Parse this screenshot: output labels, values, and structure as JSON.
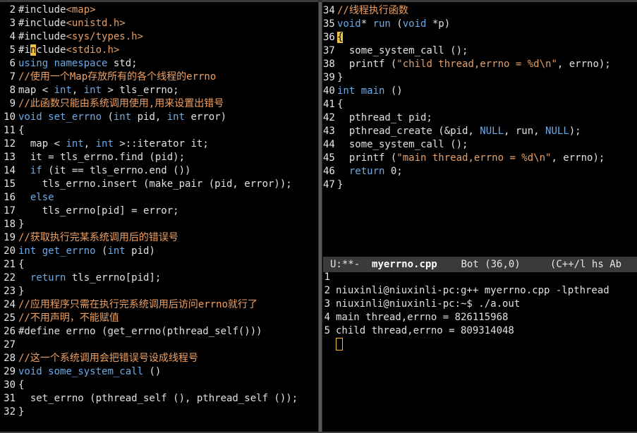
{
  "left_pane": {
    "lines": [
      {
        "n": "2",
        "parts": [
          [
            "pp",
            "#include"
          ],
          [
            "str",
            "<map>"
          ]
        ]
      },
      {
        "n": "3",
        "parts": [
          [
            "pp",
            "#include"
          ],
          [
            "str",
            "<unistd.h>"
          ]
        ]
      },
      {
        "n": "4",
        "parts": [
          [
            "pp",
            "#include"
          ],
          [
            "str",
            "<sys/types.h>"
          ]
        ]
      },
      {
        "n": "5",
        "parts": [
          [
            "pp",
            "#i"
          ],
          [
            "cur",
            "n"
          ],
          [
            "pp",
            "clude"
          ],
          [
            "str",
            "<stdio.h>"
          ]
        ]
      },
      {
        "n": "6",
        "parts": [
          [
            "k",
            "using"
          ],
          [
            "code",
            " "
          ],
          [
            "k",
            "namespace"
          ],
          [
            "code",
            " std;"
          ]
        ]
      },
      {
        "n": "7",
        "parts": [
          [
            "cm",
            "//使用一个Map存放所有的各个线程的errno"
          ]
        ]
      },
      {
        "n": "8",
        "parts": [
          [
            "code",
            "map < "
          ],
          [
            "k",
            "int"
          ],
          [
            "code",
            ", "
          ],
          [
            "k",
            "int"
          ],
          [
            "code",
            " > tls_errno;"
          ]
        ]
      },
      {
        "n": "9",
        "parts": [
          [
            "cm",
            "//此函数只能由系统调用使用,用来设置出错号"
          ]
        ]
      },
      {
        "n": "10",
        "parts": [
          [
            "k",
            "void"
          ],
          [
            "code",
            " "
          ],
          [
            "k",
            "set_errno"
          ],
          [
            "code",
            " ("
          ],
          [
            "k",
            "int"
          ],
          [
            "code",
            " pid, "
          ],
          [
            "k",
            "int"
          ],
          [
            "code",
            " error)"
          ]
        ]
      },
      {
        "n": "11",
        "parts": [
          [
            "code",
            "{"
          ]
        ]
      },
      {
        "n": "12",
        "parts": [
          [
            "code",
            "  map < "
          ],
          [
            "k",
            "int"
          ],
          [
            "code",
            ", "
          ],
          [
            "k",
            "int"
          ],
          [
            "code",
            " >::iterator it;"
          ]
        ]
      },
      {
        "n": "13",
        "parts": [
          [
            "code",
            "  it = tls_errno.find (pid);"
          ]
        ]
      },
      {
        "n": "14",
        "parts": [
          [
            "code",
            "  "
          ],
          [
            "k",
            "if"
          ],
          [
            "code",
            " (it == tls_errno.end ())"
          ]
        ]
      },
      {
        "n": "15",
        "parts": [
          [
            "code",
            "    tls_errno.insert (make_pair (pid, error));"
          ]
        ]
      },
      {
        "n": "16",
        "parts": [
          [
            "code",
            "  "
          ],
          [
            "k",
            "else"
          ]
        ]
      },
      {
        "n": "17",
        "parts": [
          [
            "code",
            "    tls_errno[pid] = error;"
          ]
        ]
      },
      {
        "n": "18",
        "parts": [
          [
            "code",
            "}"
          ]
        ]
      },
      {
        "n": "19",
        "parts": [
          [
            "cm",
            "//获取执行完某系统调用后的错误号"
          ]
        ]
      },
      {
        "n": "20",
        "parts": [
          [
            "k",
            "int"
          ],
          [
            "code",
            " "
          ],
          [
            "k",
            "get_errno"
          ],
          [
            "code",
            " ("
          ],
          [
            "k",
            "int"
          ],
          [
            "code",
            " pid)"
          ]
        ]
      },
      {
        "n": "21",
        "parts": [
          [
            "code",
            "{"
          ]
        ]
      },
      {
        "n": "22",
        "parts": [
          [
            "code",
            "  "
          ],
          [
            "k",
            "return"
          ],
          [
            "code",
            " tls_errno[pid];"
          ]
        ]
      },
      {
        "n": "23",
        "parts": [
          [
            "code",
            "}"
          ]
        ]
      },
      {
        "n": "24",
        "parts": [
          [
            "cm",
            "//应用程序只需在执行完系统调用后访问errno就行了"
          ]
        ]
      },
      {
        "n": "25",
        "parts": [
          [
            "cm",
            "//不用声明，不能赋值"
          ]
        ]
      },
      {
        "n": "26",
        "parts": [
          [
            "pp",
            "#define"
          ],
          [
            "code",
            " errno (get_errno(pthread_self()))"
          ]
        ]
      },
      {
        "n": "27",
        "parts": [
          [
            "code",
            ""
          ]
        ]
      },
      {
        "n": "28",
        "parts": [
          [
            "cm",
            "//这一个系统调用会把错误号设成线程号"
          ]
        ]
      },
      {
        "n": "29",
        "parts": [
          [
            "k",
            "void"
          ],
          [
            "code",
            " "
          ],
          [
            "k",
            "some_system_call"
          ],
          [
            "code",
            " ()"
          ]
        ]
      },
      {
        "n": "30",
        "parts": [
          [
            "code",
            "{"
          ]
        ]
      },
      {
        "n": "31",
        "parts": [
          [
            "code",
            "  set_errno (pthread_self (), pthread_self ());"
          ]
        ]
      },
      {
        "n": "32",
        "parts": [
          [
            "code",
            "}"
          ]
        ]
      }
    ]
  },
  "right_top_pane": {
    "lines": [
      {
        "n": "34",
        "parts": [
          [
            "cm",
            "//线程执行函数"
          ]
        ]
      },
      {
        "n": "35",
        "parts": [
          [
            "k",
            "void"
          ],
          [
            "code",
            "* "
          ],
          [
            "k",
            "run"
          ],
          [
            "code",
            " ("
          ],
          [
            "k",
            "void"
          ],
          [
            "code",
            " *p)"
          ]
        ]
      },
      {
        "n": "36",
        "parts": [
          [
            "cur",
            "{"
          ]
        ]
      },
      {
        "n": "37",
        "parts": [
          [
            "code",
            "  some_system_call ();"
          ]
        ]
      },
      {
        "n": "38",
        "parts": [
          [
            "code",
            "  printf ("
          ],
          [
            "str",
            "\"child thread,errno = %d\\n\""
          ],
          [
            "code",
            ", errno);"
          ]
        ]
      },
      {
        "n": "39",
        "parts": [
          [
            "code",
            "}"
          ]
        ]
      },
      {
        "n": "40",
        "parts": [
          [
            "k",
            "int"
          ],
          [
            "code",
            " "
          ],
          [
            "k",
            "main"
          ],
          [
            "code",
            " ()"
          ]
        ]
      },
      {
        "n": "41",
        "parts": [
          [
            "code",
            "{"
          ]
        ]
      },
      {
        "n": "42",
        "parts": [
          [
            "code",
            "  pthread_t pid;"
          ]
        ]
      },
      {
        "n": "43",
        "parts": [
          [
            "code",
            "  pthread_create (&pid, "
          ],
          [
            "k",
            "NULL"
          ],
          [
            "code",
            ", run, "
          ],
          [
            "k",
            "NULL"
          ],
          [
            "code",
            ");"
          ]
        ]
      },
      {
        "n": "44",
        "parts": [
          [
            "code",
            "  some_system_call ();"
          ]
        ]
      },
      {
        "n": "45",
        "parts": [
          [
            "code",
            "  printf ("
          ],
          [
            "str",
            "\"main thread,errno = %d\\n\""
          ],
          [
            "code",
            ", errno);"
          ]
        ]
      },
      {
        "n": "46",
        "parts": [
          [
            "code",
            "  "
          ],
          [
            "k",
            "return"
          ],
          [
            "code",
            " 0;"
          ]
        ]
      },
      {
        "n": "47",
        "parts": [
          [
            "code",
            "}"
          ]
        ]
      }
    ]
  },
  "modeline": {
    "status": "U:**-",
    "filename": "myerrno.cpp",
    "position": "Bot (36,0)",
    "mode": "(C++/l hs Ab"
  },
  "terminal_pane": {
    "lines": [
      {
        "n": "1",
        "text": ""
      },
      {
        "n": "2",
        "text": "niuxinli@niuxinli-pc:g++ myerrno.cpp -lpthread"
      },
      {
        "n": "3",
        "text": "niuxinli@niuxinli-pc:~$ ./a.out"
      },
      {
        "n": "4",
        "text": "main thread,errno = 826115968"
      },
      {
        "n": "5",
        "text": "child thread,errno = 809314048"
      }
    ]
  },
  "colors": {
    "keyword": "#6aaae8",
    "string": "#e4a067",
    "comment": "#f0a060",
    "cursor": "#f0c040",
    "background": "#000000"
  }
}
